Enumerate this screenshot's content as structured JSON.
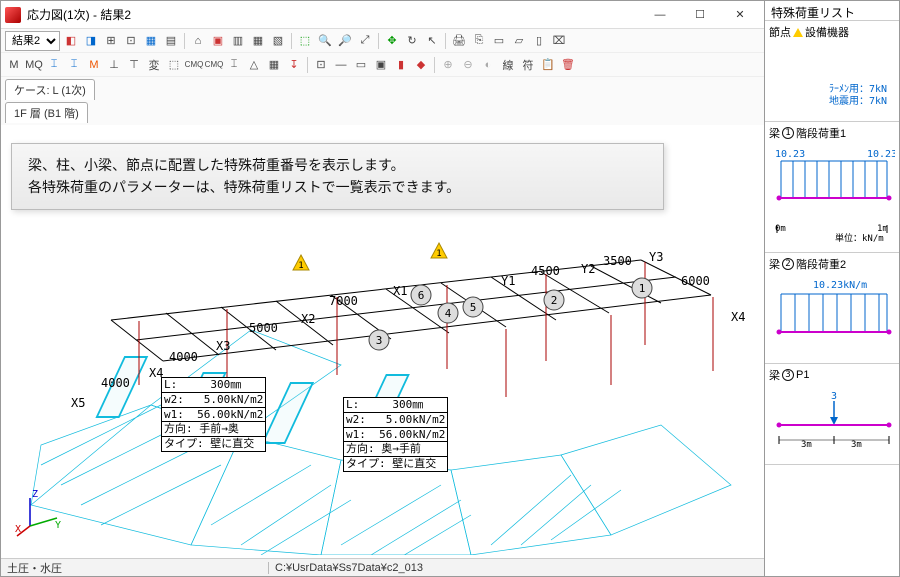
{
  "title": "応力図(1次) - 結果2",
  "combo_result": "結果2",
  "case_tab1": "ケース: L (1次)",
  "case_tab2": "1F 層 (B1 階)",
  "tooltip": {
    "line1": "梁、柱、小梁、節点に配置した特殊荷重番号を表示します。",
    "line2": "各特殊荷重のパラメーターは、特殊荷重リストで一覧表示できます。"
  },
  "statusbar": {
    "left": "土圧・水圧",
    "path": "C:¥UsrData¥Ss7Data¥c2_013"
  },
  "info1": {
    "r1": "L:     300㎜",
    "r2": "w2:   5.00kN/m2",
    "r3": "w1:  56.00kN/m2",
    "r4": "方向: 手前→奥",
    "r5": "タイプ: 壁に直交"
  },
  "info2": {
    "r1": "L:     300㎜",
    "r2": "w2:   5.00kN/m2",
    "r3": "w1:  56.00kN/m2",
    "r4": "方向: 奥→手前",
    "r5": "タイプ: 壁に直交"
  },
  "dims": {
    "d4000a": "4000",
    "d4000b": "4000",
    "d5000": "5000",
    "d7000": "7000",
    "d4500": "4500",
    "d3500": "3500",
    "d6000": "6000"
  },
  "gridlabels": {
    "x1": "X1",
    "x2": "X2",
    "x3": "X3",
    "x4": "X4",
    "x5": "X5",
    "x4r": "X4",
    "y1": "Y1",
    "y2": "Y2",
    "y3": "Y3"
  },
  "markers": {
    "m1": "1",
    "m2": "2",
    "m3": "3",
    "m4": "4",
    "m5": "5",
    "m6": "6",
    "mY1": "1"
  },
  "side": {
    "title": "特殊荷重リスト",
    "item1": {
      "head": "節点  設備機器",
      "l1": "ﾗｰﾒﾝ用：7kN",
      "l2": "地震用：7kN"
    },
    "item2": {
      "head": "梁  階段荷重1",
      "v": "10.23",
      "unit": "単位：kN/m",
      "scale0": "0m",
      "scale1": "1m"
    },
    "item3": {
      "head": "梁  階段荷重2",
      "v": "10.23kN/m"
    },
    "item4": {
      "head": "梁  P1",
      "v": "3",
      "scale0": "3m",
      "scale1": "3m"
    }
  },
  "axes": {
    "x": "X",
    "y": "Y",
    "z": "Z"
  }
}
